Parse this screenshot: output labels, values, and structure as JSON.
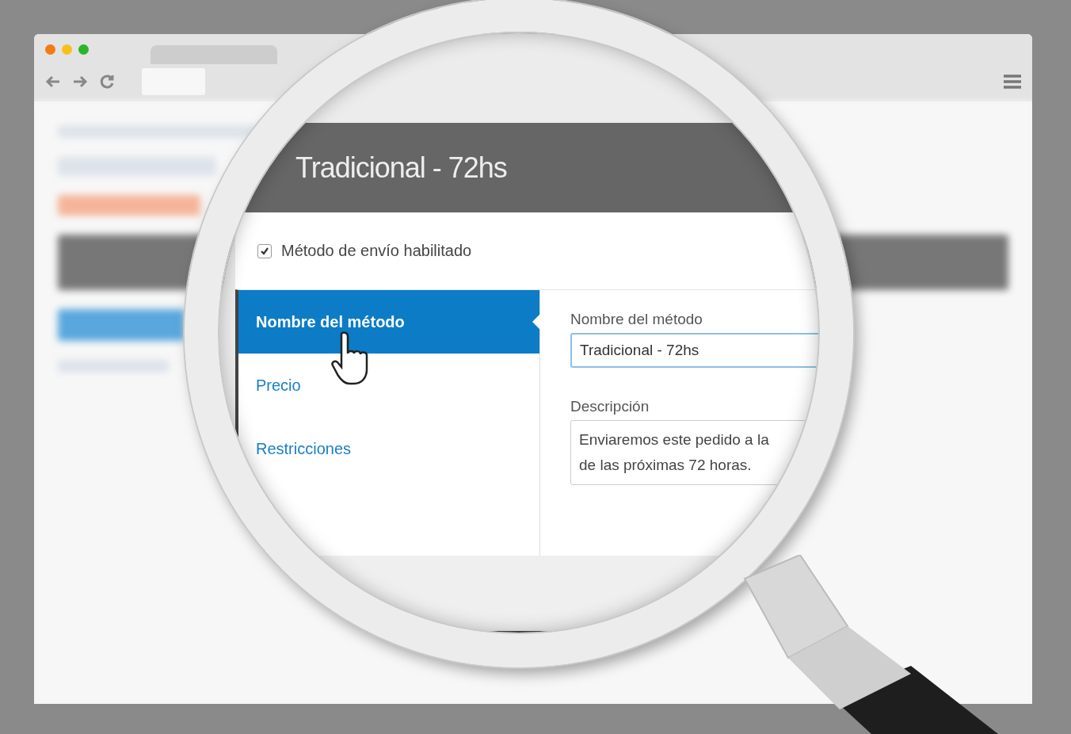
{
  "panel": {
    "title": "Tradicional - 72hs"
  },
  "enabled_checkbox": {
    "label": "Método de envío habilitado",
    "checked": true
  },
  "nav": [
    {
      "label": "Nombre del método",
      "selected": true
    },
    {
      "label": "Precio",
      "selected": false
    },
    {
      "label": "Restricciones",
      "selected": false
    }
  ],
  "fields": [
    {
      "kind": "input",
      "label": "Nombre del método",
      "value": "Tradicional - 72hs"
    },
    {
      "kind": "textarea",
      "label": "Descripción",
      "lines": [
        "Enviaremos este pedido a la",
        "de las próximas 72 horas."
      ]
    }
  ]
}
